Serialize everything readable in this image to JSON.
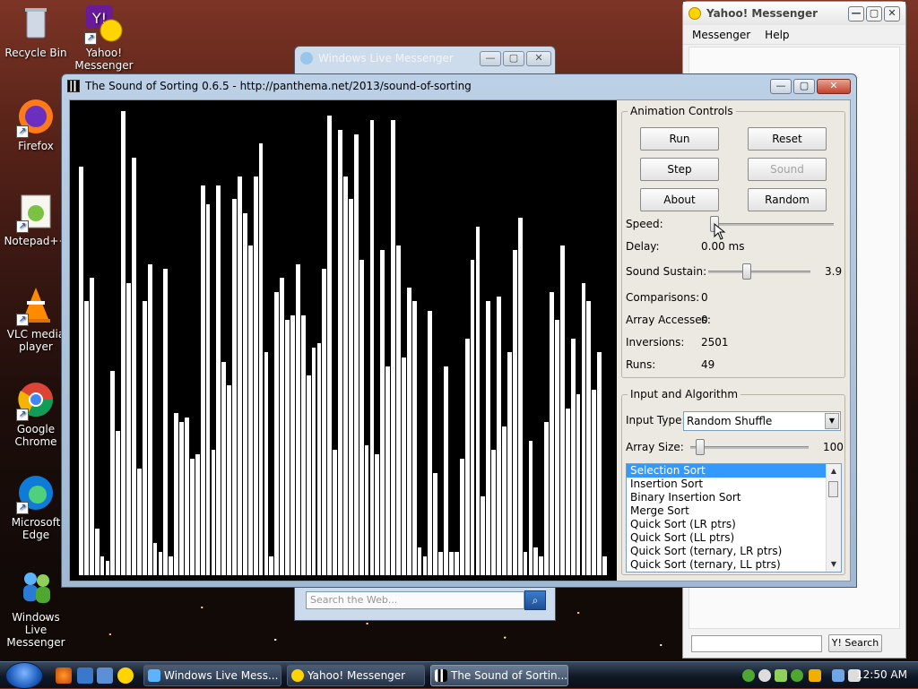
{
  "desktop": {
    "icons": [
      {
        "label": "Recycle Bin"
      },
      {
        "label": "Yahoo! Messenger"
      },
      {
        "label": "Firefox"
      },
      {
        "label": "Notepad++"
      },
      {
        "label": "VLC media player"
      },
      {
        "label": "Google Chrome"
      },
      {
        "label": "Microsoft Edge"
      },
      {
        "label": "Windows Live Messenger"
      }
    ]
  },
  "wlm_window": {
    "title": "Windows Live Messenger",
    "search_placeholder": "Search the Web..."
  },
  "yahoo_window": {
    "title": "Yahoo! Messenger",
    "menu": [
      "Messenger",
      "Help"
    ],
    "search_button": "Y! Search"
  },
  "sos_window": {
    "title": "The Sound of Sorting 0.6.5 - http://panthema.net/2013/sound-of-sorting",
    "animation_controls": {
      "title": "Animation Controls",
      "buttons": {
        "run": "Run",
        "reset": "Reset",
        "step": "Step",
        "sound": "Sound",
        "about": "About",
        "random": "Random"
      },
      "speed_label": "Speed:",
      "delay_label": "Delay:",
      "delay_value": "0.00 ms",
      "sustain_label": "Sound Sustain:",
      "sustain_value": "3.9",
      "comparisons_label": "Comparisons:",
      "comparisons_value": "0",
      "accesses_label": "Array Accesses:",
      "accesses_value": "0",
      "inversions_label": "Inversions:",
      "inversions_value": "2501",
      "runs_label": "Runs:",
      "runs_value": "49"
    },
    "input_algorithm": {
      "title": "Input and Algorithm",
      "input_type_label": "Input Type:",
      "input_type_value": "Random Shuffle",
      "array_size_label": "Array Size:",
      "array_size_value": "100",
      "algorithms": [
        "Selection Sort",
        "Insertion Sort",
        "Binary Insertion Sort",
        "Merge Sort",
        "Quick Sort (LR ptrs)",
        "Quick Sort (LL ptrs)",
        "Quick Sort (ternary, LR ptrs)",
        "Quick Sort (ternary, LL ptrs)"
      ],
      "selected_index": 0
    },
    "array_values": [
      88,
      59,
      64,
      10,
      4,
      3,
      44,
      31,
      100,
      63,
      90,
      23,
      59,
      67,
      7,
      5,
      66,
      4,
      35,
      33,
      34,
      25,
      26,
      84,
      80,
      27,
      84,
      46,
      41,
      81,
      86,
      78,
      71,
      86,
      93,
      48,
      4,
      61,
      64,
      55,
      56,
      67,
      56,
      43,
      49,
      50,
      66,
      99,
      27,
      96,
      86,
      81,
      95,
      68,
      28,
      98,
      26,
      70,
      45,
      98,
      71,
      47,
      62,
      59,
      6,
      4,
      57,
      22,
      5,
      45,
      5,
      5,
      25,
      51,
      68,
      75,
      17,
      59,
      27,
      60,
      32,
      48,
      70,
      77,
      5,
      29,
      6,
      4,
      33,
      61,
      55,
      71,
      36,
      51,
      39,
      63,
      59,
      40,
      48,
      4
    ]
  },
  "taskbar": {
    "buttons": [
      "Windows Live Mess...",
      "Yahoo! Messenger",
      "The Sound of Sortin..."
    ],
    "clock": "12:50 AM"
  }
}
